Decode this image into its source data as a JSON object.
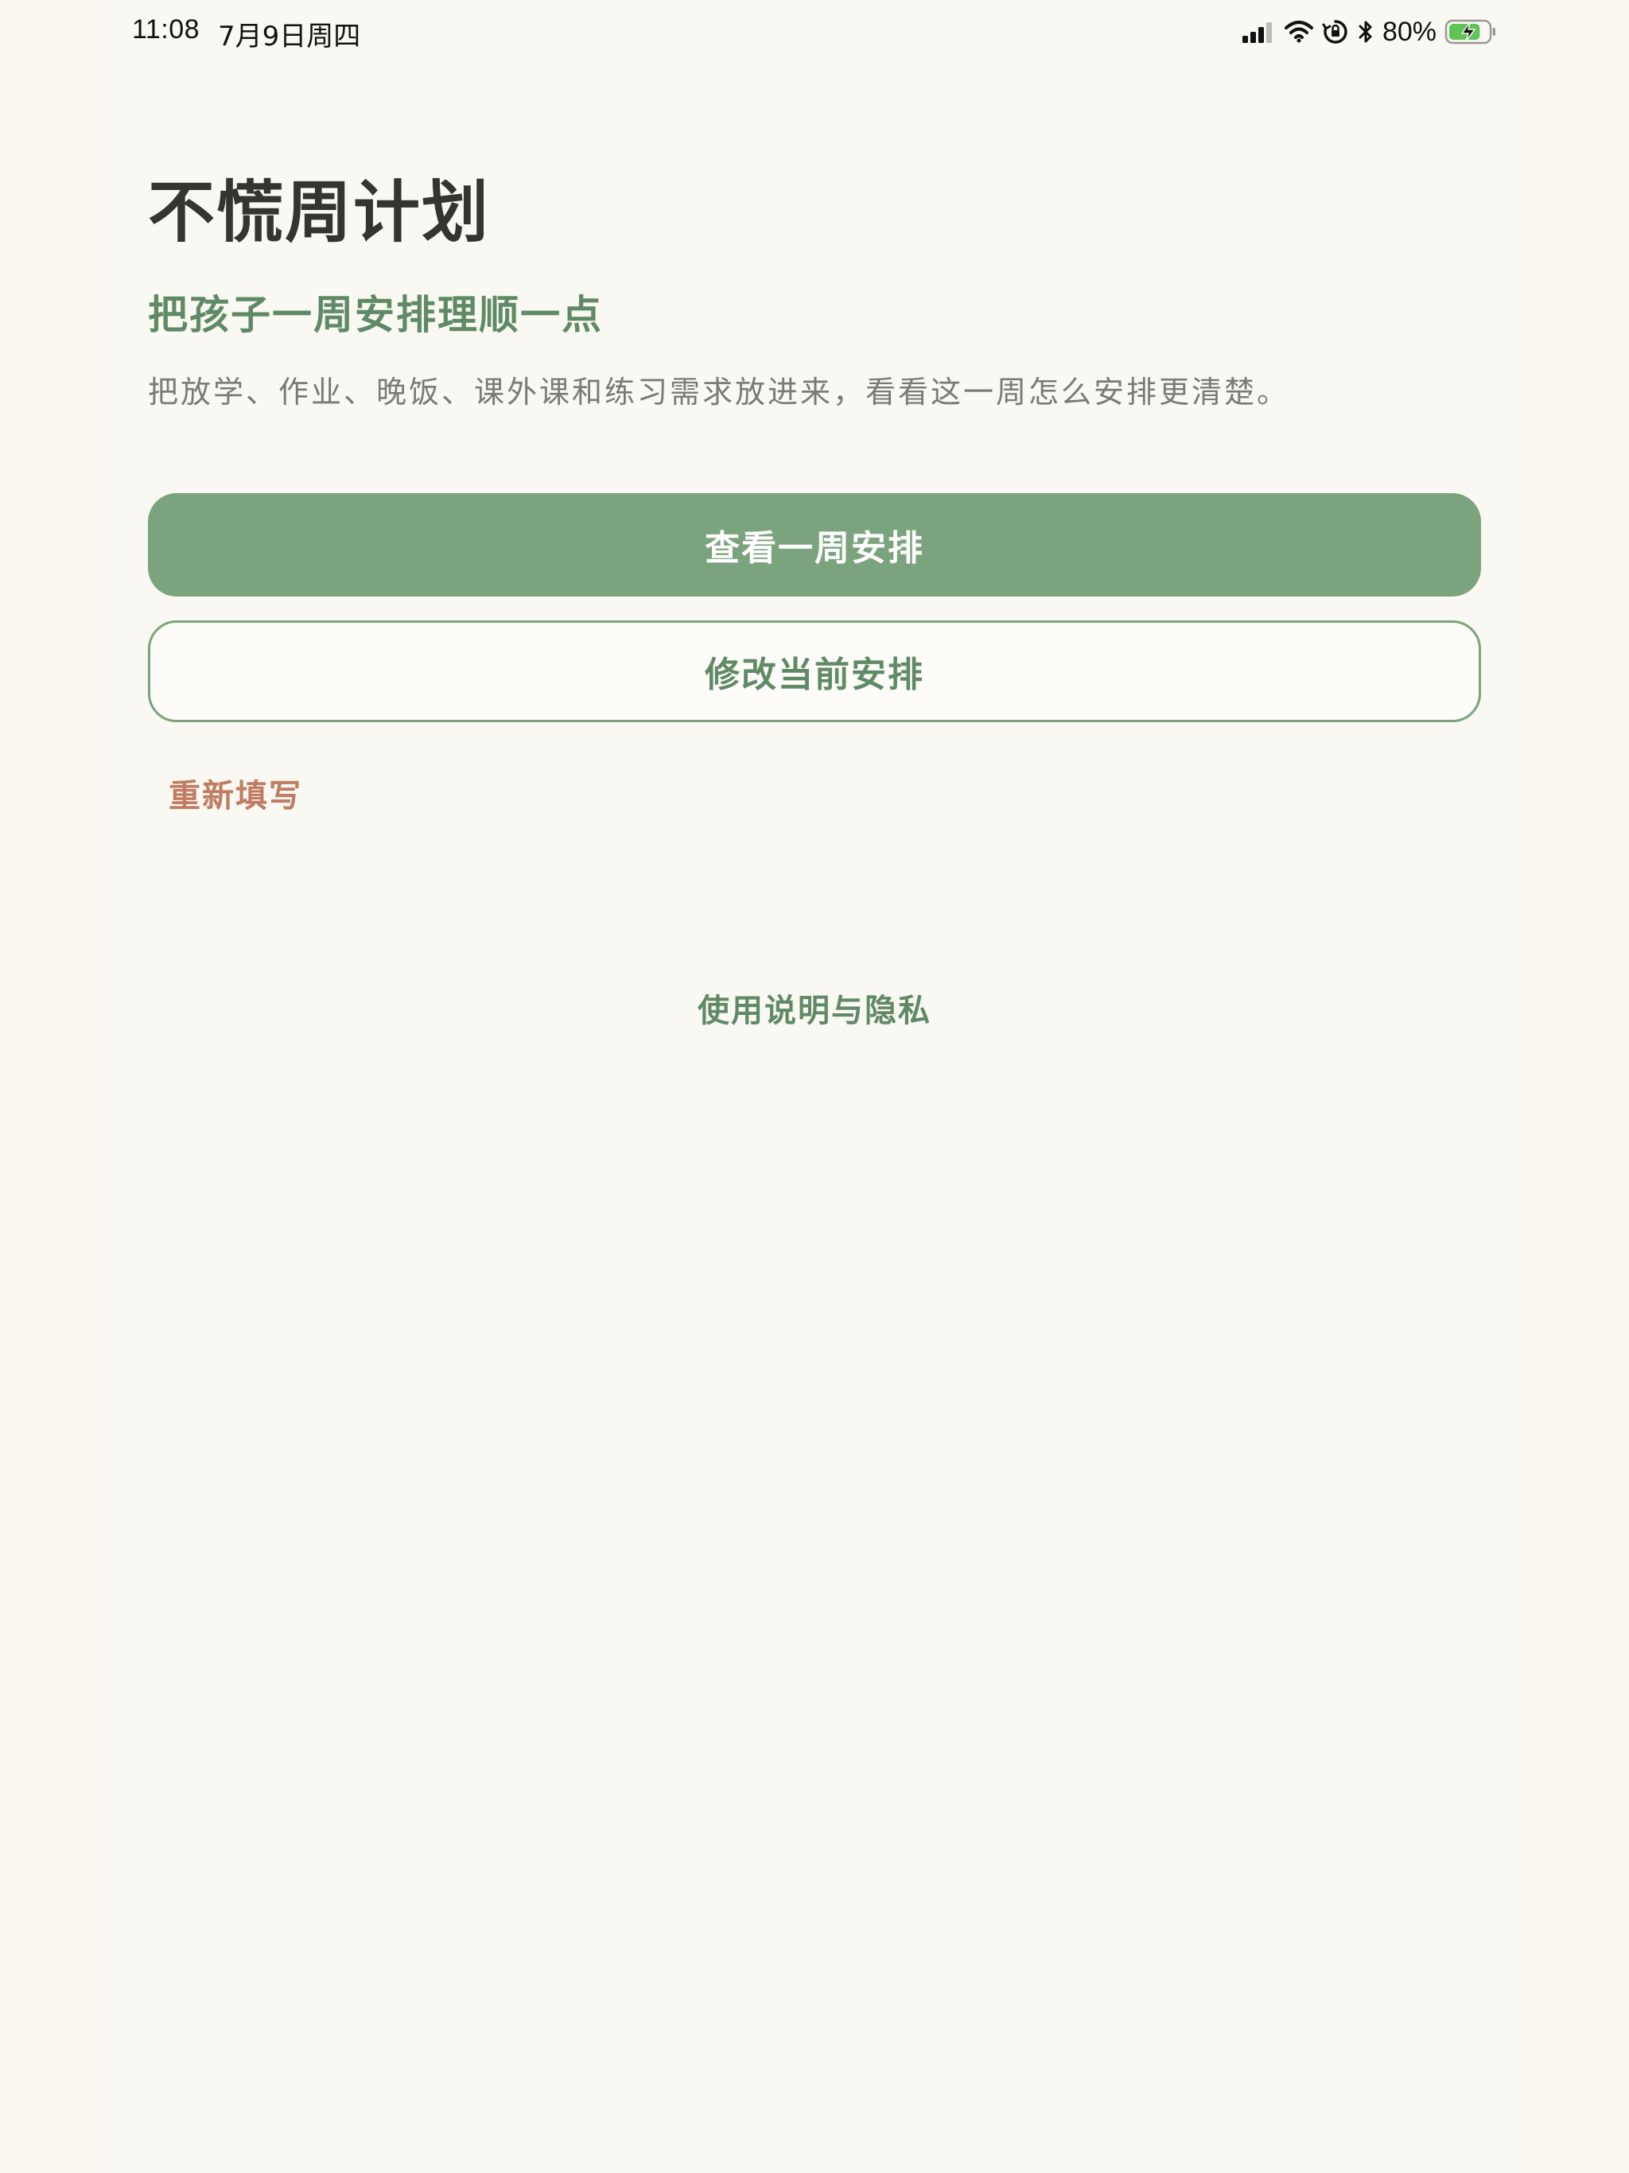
{
  "status_bar": {
    "time": "11:08",
    "date": "7月9日周四",
    "battery_percent": "80%",
    "battery_level": 0.8,
    "icons": [
      "cellular-signal-icon",
      "wifi-icon",
      "orientation-lock-icon",
      "bluetooth-icon",
      "battery-charging-icon"
    ]
  },
  "main": {
    "title": "不慌周计划",
    "subtitle": "把孩子一周安排理顺一点",
    "description": "把放学、作业、晚饭、课外课和练习需求放进来，看看这一周怎么安排更清楚。",
    "primary_button": "查看一周安排",
    "secondary_button": "修改当前安排",
    "refill_link": "重新填写",
    "help_link": "使用说明与隐私"
  },
  "colors": {
    "background": "#faf8f2",
    "accent_green": "#7ba37d",
    "text_green": "#5f8a66",
    "title_dark": "#33352f",
    "description_gray": "#7a7a76",
    "refill_orange": "#c07c62"
  }
}
